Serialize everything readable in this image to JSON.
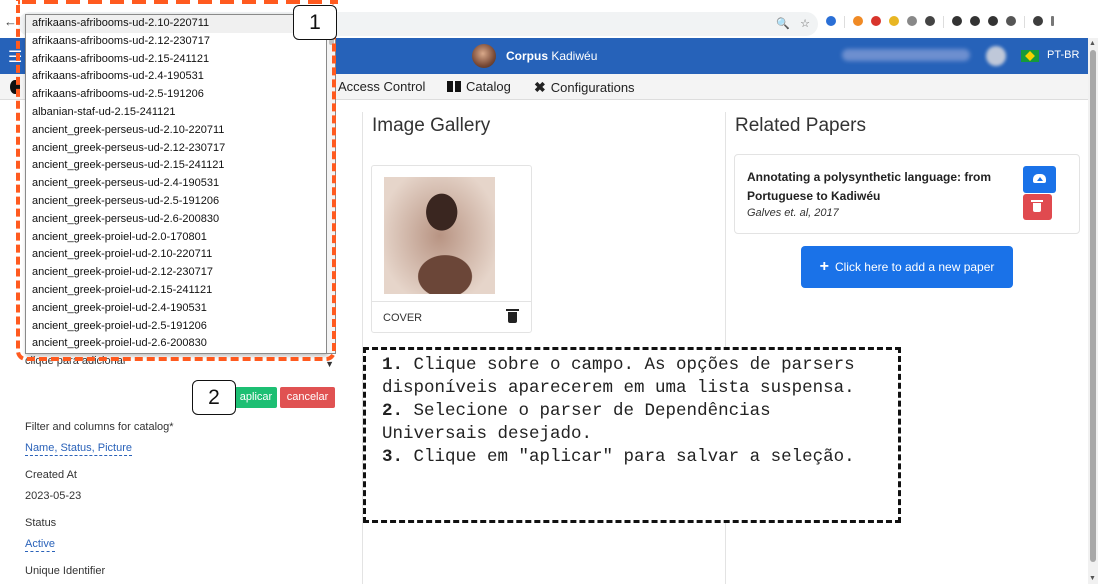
{
  "app": {
    "brand_bold": "Corpus",
    "brand_rest": " Kadiwéu",
    "language": "PT-BR"
  },
  "menu": {
    "access_control": "Access Control",
    "catalog": "Catalog",
    "configurations": "Configurations"
  },
  "parser_select": {
    "placeholder": "clique para adicionar",
    "options": [
      "afrikaans-afribooms-ud-2.10-220711",
      "afrikaans-afribooms-ud-2.12-230717",
      "afrikaans-afribooms-ud-2.15-241121",
      "afrikaans-afribooms-ud-2.4-190531",
      "afrikaans-afribooms-ud-2.5-191206",
      "albanian-staf-ud-2.15-241121",
      "ancient_greek-perseus-ud-2.10-220711",
      "ancient_greek-perseus-ud-2.12-230717",
      "ancient_greek-perseus-ud-2.15-241121",
      "ancient_greek-perseus-ud-2.4-190531",
      "ancient_greek-perseus-ud-2.5-191206",
      "ancient_greek-perseus-ud-2.6-200830",
      "ancient_greek-proiel-ud-2.0-170801",
      "ancient_greek-proiel-ud-2.10-220711",
      "ancient_greek-proiel-ud-2.12-230717",
      "ancient_greek-proiel-ud-2.15-241121",
      "ancient_greek-proiel-ud-2.4-190531",
      "ancient_greek-proiel-ud-2.5-191206",
      "ancient_greek-proiel-ud-2.6-200830"
    ],
    "apply_label": "aplicar",
    "cancel_label": "cancelar"
  },
  "details": {
    "filter_label": "Filter and columns for catalog*",
    "filter_value": "Name, Status, Picture",
    "created_label": "Created At",
    "created_value": "2023-05-23",
    "status_label": "Status",
    "status_value": "Active",
    "uid_label": "Unique Identifier"
  },
  "gallery": {
    "title": "Image Gallery",
    "caption": "COVER"
  },
  "papers": {
    "title": "Related Papers",
    "paper_title": "Annotating a polysynthetic language: from Portuguese to Kadiwéu",
    "paper_authors": "Galves et. al, 2017",
    "add_label": "Click here to add a new paper"
  },
  "annotations": {
    "callout_1": "1",
    "callout_2": "2",
    "step1_num": "1.",
    "step1_text": " Clique sobre o campo. As opções de parsers disponíveis aparecerem em uma lista suspensa.",
    "step2_num": "2.",
    "step2_text": " Selecione o parser de Dependências Universais desejado.",
    "step3_num": "3.",
    "step3_text": " Clique em \"aplicar\" para salvar a seleção."
  },
  "colors": {
    "navbar": "#2662b9",
    "primary_button": "#1a72e8",
    "apply_button": "#1dbf73",
    "cancel_button": "#e05252",
    "annotation_orange": "#ff5a1f"
  }
}
